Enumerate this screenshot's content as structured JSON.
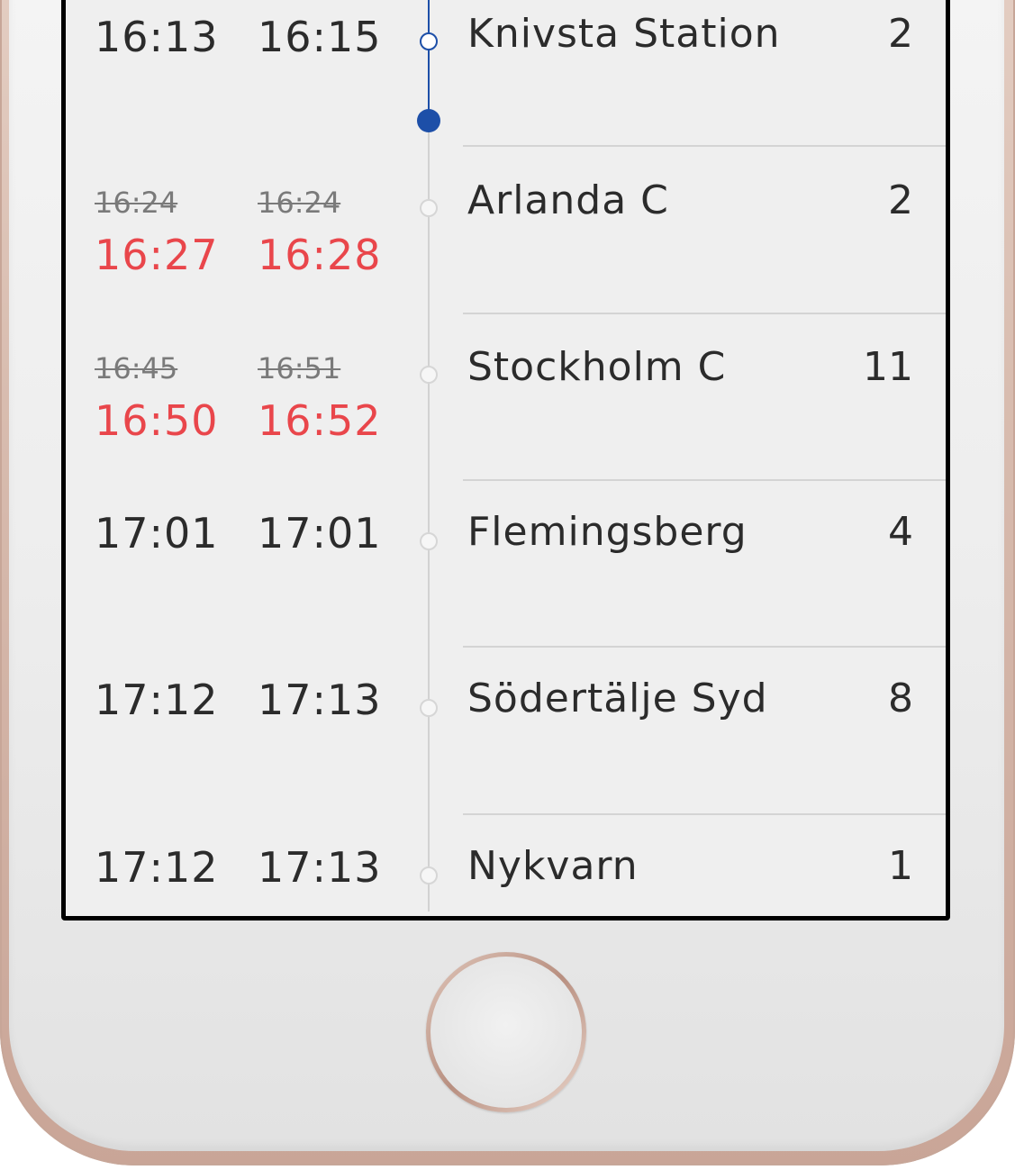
{
  "stops": [
    {
      "arrival": "16:13",
      "departure": "16:15",
      "arrival_old": "",
      "departure_old": "",
      "delayed": false,
      "name": "Knivsta Station",
      "track": "2",
      "status": "passed"
    },
    {
      "arrival": "16:27",
      "departure": "16:28",
      "arrival_old": "16:24",
      "departure_old": "16:24",
      "delayed": true,
      "name": "Arlanda C",
      "track": "2",
      "status": "upcoming"
    },
    {
      "arrival": "16:50",
      "departure": "16:52",
      "arrival_old": "16:45",
      "departure_old": "16:51",
      "delayed": true,
      "name": "Stockholm C",
      "track": "11",
      "status": "upcoming"
    },
    {
      "arrival": "17:01",
      "departure": "17:01",
      "arrival_old": "",
      "departure_old": "",
      "delayed": false,
      "name": "Flemingsberg",
      "track": "4",
      "status": "upcoming"
    },
    {
      "arrival": "17:12",
      "departure": "17:13",
      "arrival_old": "",
      "departure_old": "",
      "delayed": false,
      "name": "Södertälje Syd",
      "track": "8",
      "status": "upcoming"
    },
    {
      "arrival": "17:12",
      "departure": "17:13",
      "arrival_old": "",
      "departure_old": "",
      "delayed": false,
      "name": "Nykvarn",
      "track": "1",
      "status": "upcoming"
    }
  ],
  "colors": {
    "delay": "#e9464b",
    "progress": "#1d4fa8",
    "text": "#2b2b2b",
    "struck_time": "#7a7a7a",
    "background": "#efefef"
  },
  "icons": {
    "stop_marker": "hollow-circle-icon",
    "current_position": "filled-circle-icon",
    "home_button": "home-button"
  }
}
